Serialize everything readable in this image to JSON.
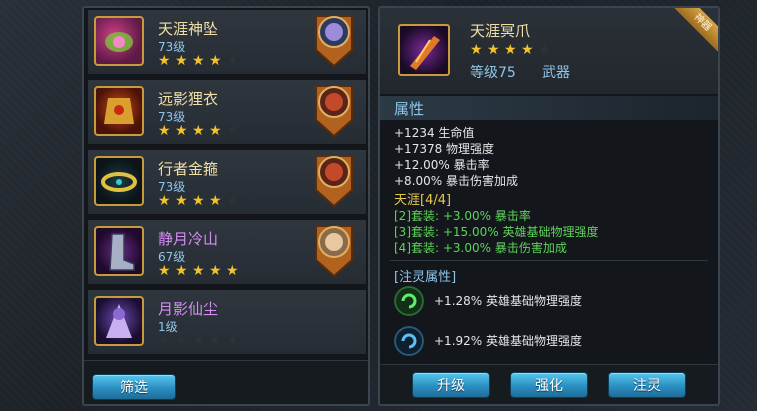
{
  "items": [
    {
      "name": "天涯神坠",
      "level": "73级",
      "stars": [
        1,
        1,
        1,
        1,
        0
      ],
      "name_color": "gold"
    },
    {
      "name": "远影狸衣",
      "level": "73级",
      "stars": [
        1,
        1,
        1,
        1,
        0
      ],
      "name_color": "gold"
    },
    {
      "name": "行者金箍",
      "level": "73级",
      "stars": [
        1,
        1,
        1,
        1,
        0
      ],
      "name_color": "gold"
    },
    {
      "name": "静月冷山",
      "level": "67级",
      "stars": [
        1,
        1,
        1,
        1,
        1
      ],
      "name_color": "purple"
    },
    {
      "name": "月影仙尘",
      "level": "1级",
      "stars": [
        0,
        0,
        0,
        0,
        0
      ],
      "name_color": "purple"
    }
  ],
  "filter_button": "筛选",
  "detail": {
    "name": "天涯冥爪",
    "stars": [
      1,
      1,
      1,
      1,
      0
    ],
    "level": "等级75",
    "type": "武器",
    "badge": "神器"
  },
  "attributes": {
    "title": "属性",
    "stats": [
      "+1234 生命值",
      "+17378 物理强度",
      "+12.00% 暴击率",
      "+8.00% 暴击伤害加成"
    ],
    "set_title": "天涯[4/4]",
    "set_stats": [
      "[2]套装: +3.00% 暴击率",
      "[3]套装: +15.00% 英雄基础物理强度",
      "[4]套装: +3.00% 暴击伤害加成"
    ],
    "soul_title": "[注灵属性]",
    "soul_stats": [
      "+1.28% 英雄基础物理强度",
      "+1.92% 英雄基础物理强度"
    ]
  },
  "buttons": {
    "upgrade": "升级",
    "enhance": "强化",
    "infuse": "注灵"
  },
  "colors": {
    "gold": "#f0e0a8",
    "purple": "#d68cf4",
    "level_blue": "#8fc6ea",
    "star": "#f2c429",
    "set_green": "#5fd35a",
    "set_yellow": "#e8c74a"
  }
}
